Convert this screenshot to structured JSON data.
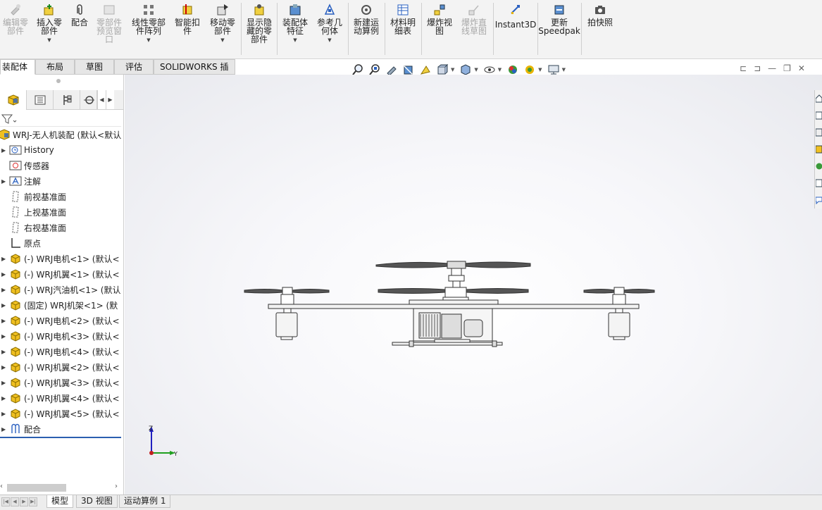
{
  "ribbon": {
    "buttons": [
      {
        "label": "编辑零\n部件",
        "icon": "edit-component-icon",
        "disabled": true
      },
      {
        "label": "插入零\n部件",
        "icon": "insert-components-icon",
        "disabled": false,
        "dropdown": true
      },
      {
        "label": "配合",
        "icon": "mate-icon",
        "disabled": false
      },
      {
        "label": "零部件\n预览窗\n口",
        "icon": "component-preview-icon",
        "disabled": true
      },
      {
        "label": "线性零部\n件阵列",
        "icon": "linear-pattern-icon",
        "disabled": false,
        "dropdown": true
      },
      {
        "label": "智能扣\n件",
        "icon": "smart-fasteners-icon",
        "disabled": false
      },
      {
        "label": "移动零\n部件",
        "icon": "move-component-icon",
        "disabled": false,
        "dropdown": true
      },
      {
        "label": "显示隐\n藏的零\n部件",
        "icon": "show-hidden-icon",
        "disabled": false
      },
      {
        "label": "装配体\n特征",
        "icon": "assembly-features-icon",
        "disabled": false,
        "dropdown": true
      },
      {
        "label": "参考几\n何体",
        "icon": "reference-geometry-icon",
        "disabled": false,
        "dropdown": true
      },
      {
        "label": "新建运\n动算例",
        "icon": "new-motion-study-icon",
        "disabled": false
      },
      {
        "label": "材料明\n细表",
        "icon": "bill-of-materials-icon",
        "disabled": false
      },
      {
        "label": "爆炸视\n图",
        "icon": "exploded-view-icon",
        "disabled": false
      },
      {
        "label": "爆炸直\n线草图",
        "icon": "explode-line-sketch-icon",
        "disabled": true
      },
      {
        "label": "Instant3D",
        "icon": "instant3d-icon",
        "disabled": false
      },
      {
        "label": "更新\nSpeedpak",
        "icon": "update-speedpak-icon",
        "disabled": false
      },
      {
        "label": "拍快照",
        "icon": "snapshot-icon",
        "disabled": false
      }
    ]
  },
  "command_tabs": [
    "装配体",
    "布局",
    "草图",
    "评估",
    "SOLIDWORKS 插件"
  ],
  "tree": {
    "root": "WRJ-无人机装配 (默认<默认",
    "items": [
      {
        "label": "History",
        "icon": "history-icon",
        "expandable": true
      },
      {
        "label": "传感器",
        "icon": "sensors-icon",
        "expandable": false
      },
      {
        "label": "注解",
        "icon": "annotations-icon",
        "expandable": true
      },
      {
        "label": "前视基准面",
        "icon": "plane-icon",
        "expandable": false
      },
      {
        "label": "上视基准面",
        "icon": "plane-icon",
        "expandable": false
      },
      {
        "label": "右视基准面",
        "icon": "plane-icon",
        "expandable": false
      },
      {
        "label": "原点",
        "icon": "origin-icon",
        "expandable": false
      },
      {
        "label": "(-) WRJ电机<1> (默认<",
        "icon": "part-icon",
        "expandable": true
      },
      {
        "label": "(-) WRJ机翼<1> (默认<",
        "icon": "part-icon",
        "expandable": true
      },
      {
        "label": "(-) WRJ汽油机<1> (默认",
        "icon": "part-icon",
        "expandable": true
      },
      {
        "label": "(固定) WRJ机架<1> (默",
        "icon": "part-icon",
        "expandable": true
      },
      {
        "label": "(-) WRJ电机<2> (默认<",
        "icon": "part-icon",
        "expandable": true
      },
      {
        "label": "(-) WRJ电机<3> (默认<",
        "icon": "part-icon",
        "expandable": true
      },
      {
        "label": "(-) WRJ电机<4> (默认<",
        "icon": "part-icon",
        "expandable": true
      },
      {
        "label": "(-) WRJ机翼<2> (默认<",
        "icon": "part-icon",
        "expandable": true
      },
      {
        "label": "(-) WRJ机翼<3> (默认<",
        "icon": "part-icon",
        "expandable": true
      },
      {
        "label": "(-) WRJ机翼<4> (默认<",
        "icon": "part-icon",
        "expandable": true
      },
      {
        "label": "(-) WRJ机翼<5> (默认<",
        "icon": "part-icon",
        "expandable": true
      },
      {
        "label": "配合",
        "icon": "mates-icon",
        "expandable": true
      }
    ]
  },
  "triad": {
    "z": "Z",
    "y": "Y"
  },
  "bottom_tabs": [
    "模型",
    "3D 视图",
    "运动算例 1"
  ],
  "colors": {
    "accent": "#2b5fb0",
    "part_yellow": "#e8b400",
    "ribbon_bg": "#f3f3f3"
  }
}
